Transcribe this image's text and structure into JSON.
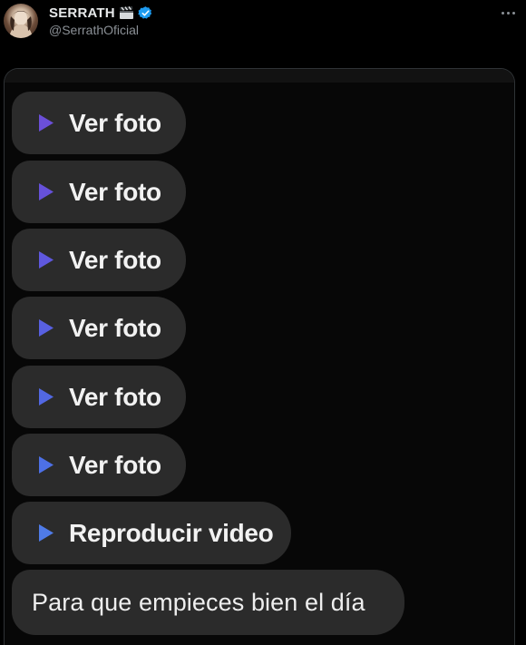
{
  "tweet": {
    "display_name": "SERRATH",
    "handle": "@SerrathOficial",
    "name_emoji_icon": "clapper-board-icon",
    "verified_icon": "verified-badge-icon",
    "more_icon": "more-options-icon"
  },
  "chat": {
    "play_icon": "play-icon",
    "bubbles": [
      {
        "label": "Ver foto"
      },
      {
        "label": "Ver foto"
      },
      {
        "label": "Ver foto"
      },
      {
        "label": "Ver foto"
      },
      {
        "label": "Ver foto"
      },
      {
        "label": "Ver foto"
      },
      {
        "label": "Reproducir video"
      }
    ],
    "message": "Para que empieces bien el día"
  },
  "colors": {
    "background": "#000000",
    "bubble": "#2b2b2b",
    "play_purple": "#6b4fd8",
    "play_blue": "#4f7be8",
    "verified_blue": "#1d9bf0"
  }
}
